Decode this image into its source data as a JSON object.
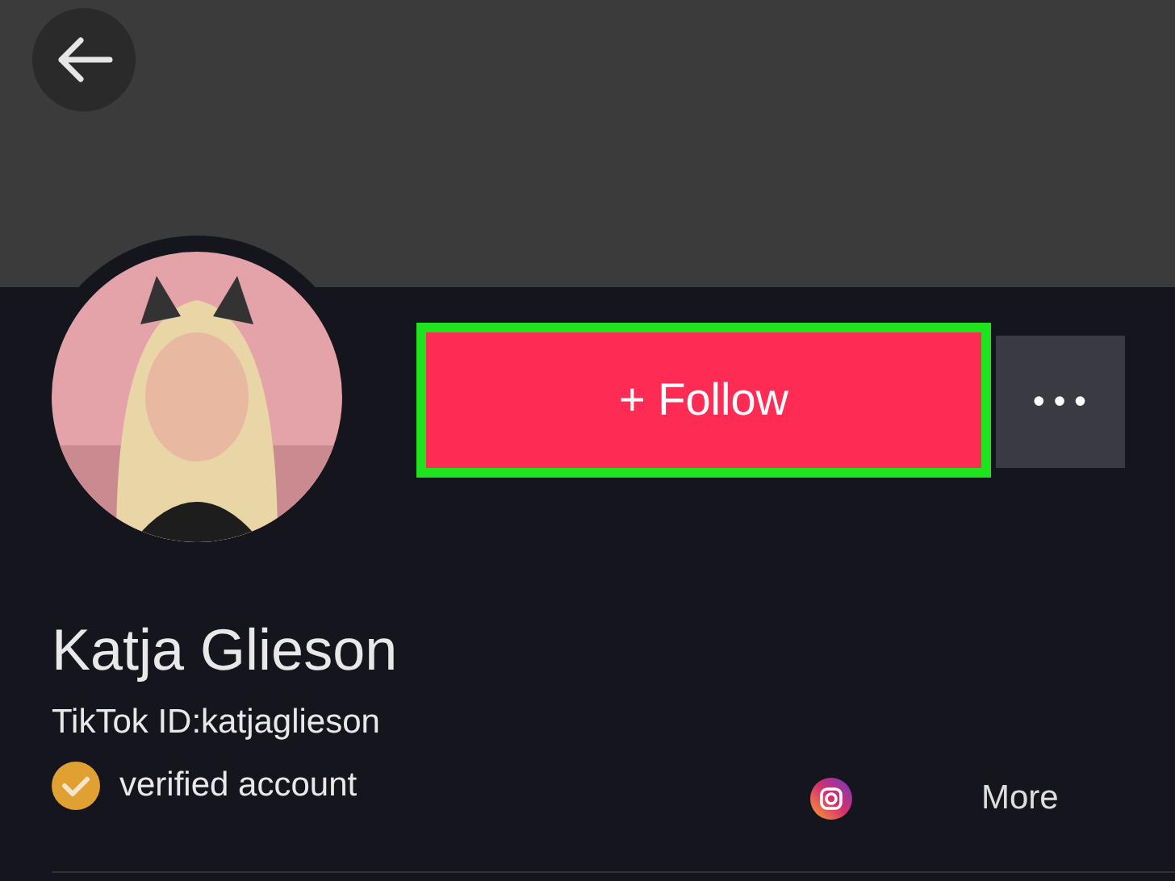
{
  "profile": {
    "name": "Katja Glieson",
    "tiktok_id": "TikTok ID:katjaglieson",
    "verified_label": "verified account"
  },
  "follow_button": {
    "label": "+ Follow",
    "highlighted": true
  },
  "more_button": {
    "label": "•••"
  },
  "social": {
    "more_label": "More"
  }
}
